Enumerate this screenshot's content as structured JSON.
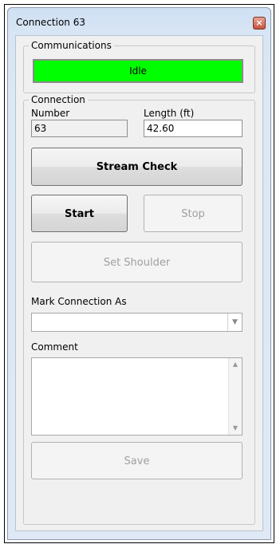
{
  "window": {
    "title": "Connection 63",
    "close_glyph": "×"
  },
  "communications": {
    "legend": "Communications",
    "status": "Idle",
    "status_color": "#00ff00"
  },
  "connection": {
    "legend": "Connection",
    "number_label": "Number",
    "number_value": "63",
    "length_label": "Length (ft)",
    "length_value": "42.60"
  },
  "buttons": {
    "stream_check": "Stream Check",
    "start": "Start",
    "stop": "Stop",
    "set_shoulder": "Set Shoulder",
    "save": "Save"
  },
  "mark": {
    "label": "Mark Connection As",
    "selected": ""
  },
  "comment": {
    "label": "Comment",
    "value": ""
  },
  "icons": {
    "close": "close-icon",
    "dropdown": "chevron-down-icon",
    "scroll_up": "scroll-up-icon",
    "scroll_down": "scroll-down-icon"
  }
}
